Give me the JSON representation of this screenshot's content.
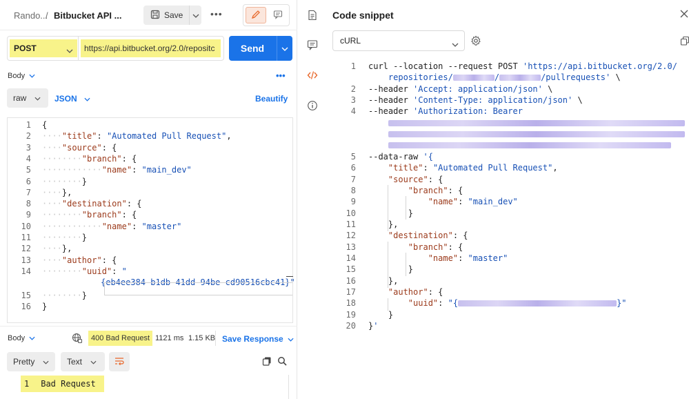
{
  "topbar": {
    "collection": "Rando...",
    "separator": "/",
    "request_name": "Bitbucket API ...",
    "save_label": "Save",
    "more": "•••"
  },
  "request": {
    "method": "POST",
    "url": "https://api.bitbucket.org/2.0/repositc",
    "send_label": "Send"
  },
  "body_section": {
    "tab_label": "Body",
    "more": "•••",
    "mode": "raw",
    "language": "JSON",
    "beautify_label": "Beautify"
  },
  "editor_lines": [
    {
      "n": "1",
      "indent": "",
      "parts": [
        [
          "p",
          "{"
        ]
      ]
    },
    {
      "n": "2",
      "indent": "····",
      "parts": [
        [
          "k",
          "\"title\""
        ],
        [
          "p",
          ": "
        ],
        [
          "s",
          "\"Automated Pull Request\""
        ],
        [
          "p",
          ","
        ]
      ]
    },
    {
      "n": "3",
      "indent": "····",
      "parts": [
        [
          "k",
          "\"source\""
        ],
        [
          "p",
          ": {"
        ]
      ]
    },
    {
      "n": "4",
      "indent": "········",
      "parts": [
        [
          "k",
          "\"branch\""
        ],
        [
          "p",
          ": {"
        ]
      ]
    },
    {
      "n": "5",
      "indent": "············",
      "parts": [
        [
          "k",
          "\"name\""
        ],
        [
          "p",
          ": "
        ],
        [
          "s",
          "\"main_dev\""
        ]
      ]
    },
    {
      "n": "6",
      "indent": "········",
      "parts": [
        [
          "p",
          "}"
        ]
      ]
    },
    {
      "n": "7",
      "indent": "····",
      "parts": [
        [
          "p",
          "},"
        ]
      ]
    },
    {
      "n": "8",
      "indent": "····",
      "parts": [
        [
          "k",
          "\"destination\""
        ],
        [
          "p",
          ": {"
        ]
      ]
    },
    {
      "n": "9",
      "indent": "········",
      "parts": [
        [
          "k",
          "\"branch\""
        ],
        [
          "p",
          ": {"
        ]
      ]
    },
    {
      "n": "10",
      "indent": "············",
      "parts": [
        [
          "k",
          "\"name\""
        ],
        [
          "p",
          ": "
        ],
        [
          "s",
          "\"master\""
        ]
      ]
    },
    {
      "n": "11",
      "indent": "········",
      "parts": [
        [
          "p",
          "}"
        ]
      ]
    },
    {
      "n": "12",
      "indent": "····",
      "parts": [
        [
          "p",
          "},"
        ]
      ]
    },
    {
      "n": "13",
      "indent": "····",
      "parts": [
        [
          "k",
          "\"author\""
        ],
        [
          "p",
          ": {"
        ]
      ]
    },
    {
      "n": "14",
      "indent": "········",
      "parts": [
        [
          "k",
          "\"uuid\""
        ],
        [
          "p",
          ": "
        ],
        [
          "s",
          "\""
        ]
      ]
    },
    {
      "n": "",
      "indent": "",
      "parts": [
        [
          "s",
          "{eb4ee384-b1db-41dd-94be-cd90516cbc41}\""
        ]
      ]
    },
    {
      "n": "15",
      "indent": "········",
      "parts": [
        [
          "p",
          "}"
        ]
      ]
    },
    {
      "n": "16",
      "indent": "",
      "parts": [
        [
          "p",
          "}"
        ]
      ]
    }
  ],
  "response": {
    "tab_label": "Body",
    "status": "400 Bad Request",
    "time": "1121 ms",
    "size": "1.15 KB",
    "save_label": "Save Response",
    "format": "Pretty",
    "type": "Text",
    "line_number": "1",
    "line_text": "Bad Request"
  },
  "snippet": {
    "title": "Code snippet",
    "language": "cURL",
    "lines": [
      {
        "n": "1",
        "parts": [
          [
            "p",
            "curl --location --request POST "
          ],
          [
            "s",
            "'https://api.bitbucket.org/2.0/"
          ]
        ]
      },
      {
        "n": "",
        "parts": [
          [
            "p",
            "    "
          ],
          [
            "s",
            "repositories/"
          ],
          [
            "b",
            "60"
          ],
          [
            "s",
            "/"
          ],
          [
            "b",
            "60"
          ],
          [
            "s",
            "/pullrequests'"
          ],
          [
            "p",
            " \\"
          ]
        ]
      },
      {
        "n": "2",
        "parts": [
          [
            "p",
            "--header "
          ],
          [
            "s",
            "'Accept: application/json'"
          ],
          [
            "p",
            " \\"
          ]
        ]
      },
      {
        "n": "3",
        "parts": [
          [
            "p",
            "--header "
          ],
          [
            "s",
            "'Content-Type: application/json'"
          ],
          [
            "p",
            " \\"
          ]
        ]
      },
      {
        "n": "4",
        "parts": [
          [
            "p",
            "--header "
          ],
          [
            "s",
            "'Authorization: Bearer"
          ]
        ]
      },
      {
        "n": "",
        "parts": [
          [
            "p",
            "    "
          ],
          [
            "b",
            "430"
          ]
        ]
      },
      {
        "n": "",
        "parts": [
          [
            "p",
            "    "
          ],
          [
            "b",
            "430"
          ]
        ]
      },
      {
        "n": "",
        "parts": [
          [
            "p",
            "    "
          ],
          [
            "b",
            "410"
          ]
        ]
      },
      {
        "n": "5",
        "parts": [
          [
            "p",
            "--data-raw "
          ],
          [
            "s",
            "'{"
          ]
        ]
      },
      {
        "n": "6",
        "parts": [
          [
            "p",
            "    "
          ],
          [
            "k",
            "\"title\""
          ],
          [
            "p",
            ": "
          ],
          [
            "s",
            "\"Automated Pull Request\""
          ],
          [
            "p",
            ","
          ]
        ]
      },
      {
        "n": "7",
        "parts": [
          [
            "p",
            "    "
          ],
          [
            "k",
            "\"source\""
          ],
          [
            "p",
            ": {"
          ]
        ]
      },
      {
        "n": "8",
        "parts": [
          [
            "p",
            "        "
          ],
          [
            "k",
            "\"branch\""
          ],
          [
            "p",
            ": {"
          ]
        ]
      },
      {
        "n": "9",
        "parts": [
          [
            "p",
            "            "
          ],
          [
            "k",
            "\"name\""
          ],
          [
            "p",
            ": "
          ],
          [
            "s",
            "\"main_dev\""
          ]
        ]
      },
      {
        "n": "10",
        "parts": [
          [
            "p",
            "        }"
          ]
        ]
      },
      {
        "n": "11",
        "parts": [
          [
            "p",
            "    },"
          ]
        ]
      },
      {
        "n": "12",
        "parts": [
          [
            "p",
            "    "
          ],
          [
            "k",
            "\"destination\""
          ],
          [
            "p",
            ": {"
          ]
        ]
      },
      {
        "n": "13",
        "parts": [
          [
            "p",
            "        "
          ],
          [
            "k",
            "\"branch\""
          ],
          [
            "p",
            ": {"
          ]
        ]
      },
      {
        "n": "14",
        "parts": [
          [
            "p",
            "            "
          ],
          [
            "k",
            "\"name\""
          ],
          [
            "p",
            ": "
          ],
          [
            "s",
            "\"master\""
          ]
        ]
      },
      {
        "n": "15",
        "parts": [
          [
            "p",
            "        }"
          ]
        ]
      },
      {
        "n": "16",
        "parts": [
          [
            "p",
            "    },"
          ]
        ]
      },
      {
        "n": "17",
        "parts": [
          [
            "p",
            "    "
          ],
          [
            "k",
            "\"author\""
          ],
          [
            "p",
            ": {"
          ]
        ]
      },
      {
        "n": "18",
        "parts": [
          [
            "p",
            "        "
          ],
          [
            "k",
            "\"uuid\""
          ],
          [
            "p",
            ": "
          ],
          [
            "s",
            "\"{"
          ],
          [
            "b",
            "230"
          ],
          [
            "s",
            "}\""
          ]
        ]
      },
      {
        "n": "19",
        "parts": [
          [
            "p",
            "    }"
          ]
        ]
      },
      {
        "n": "20",
        "parts": [
          [
            "p",
            "}"
          ],
          [
            "s",
            "'"
          ]
        ]
      }
    ]
  },
  "colors": {
    "accent": "#1a73e8",
    "highlight": "#f8f38a",
    "key": "#9b3a1b",
    "string": "#1750b5",
    "edit_mode": "#e8692c"
  }
}
